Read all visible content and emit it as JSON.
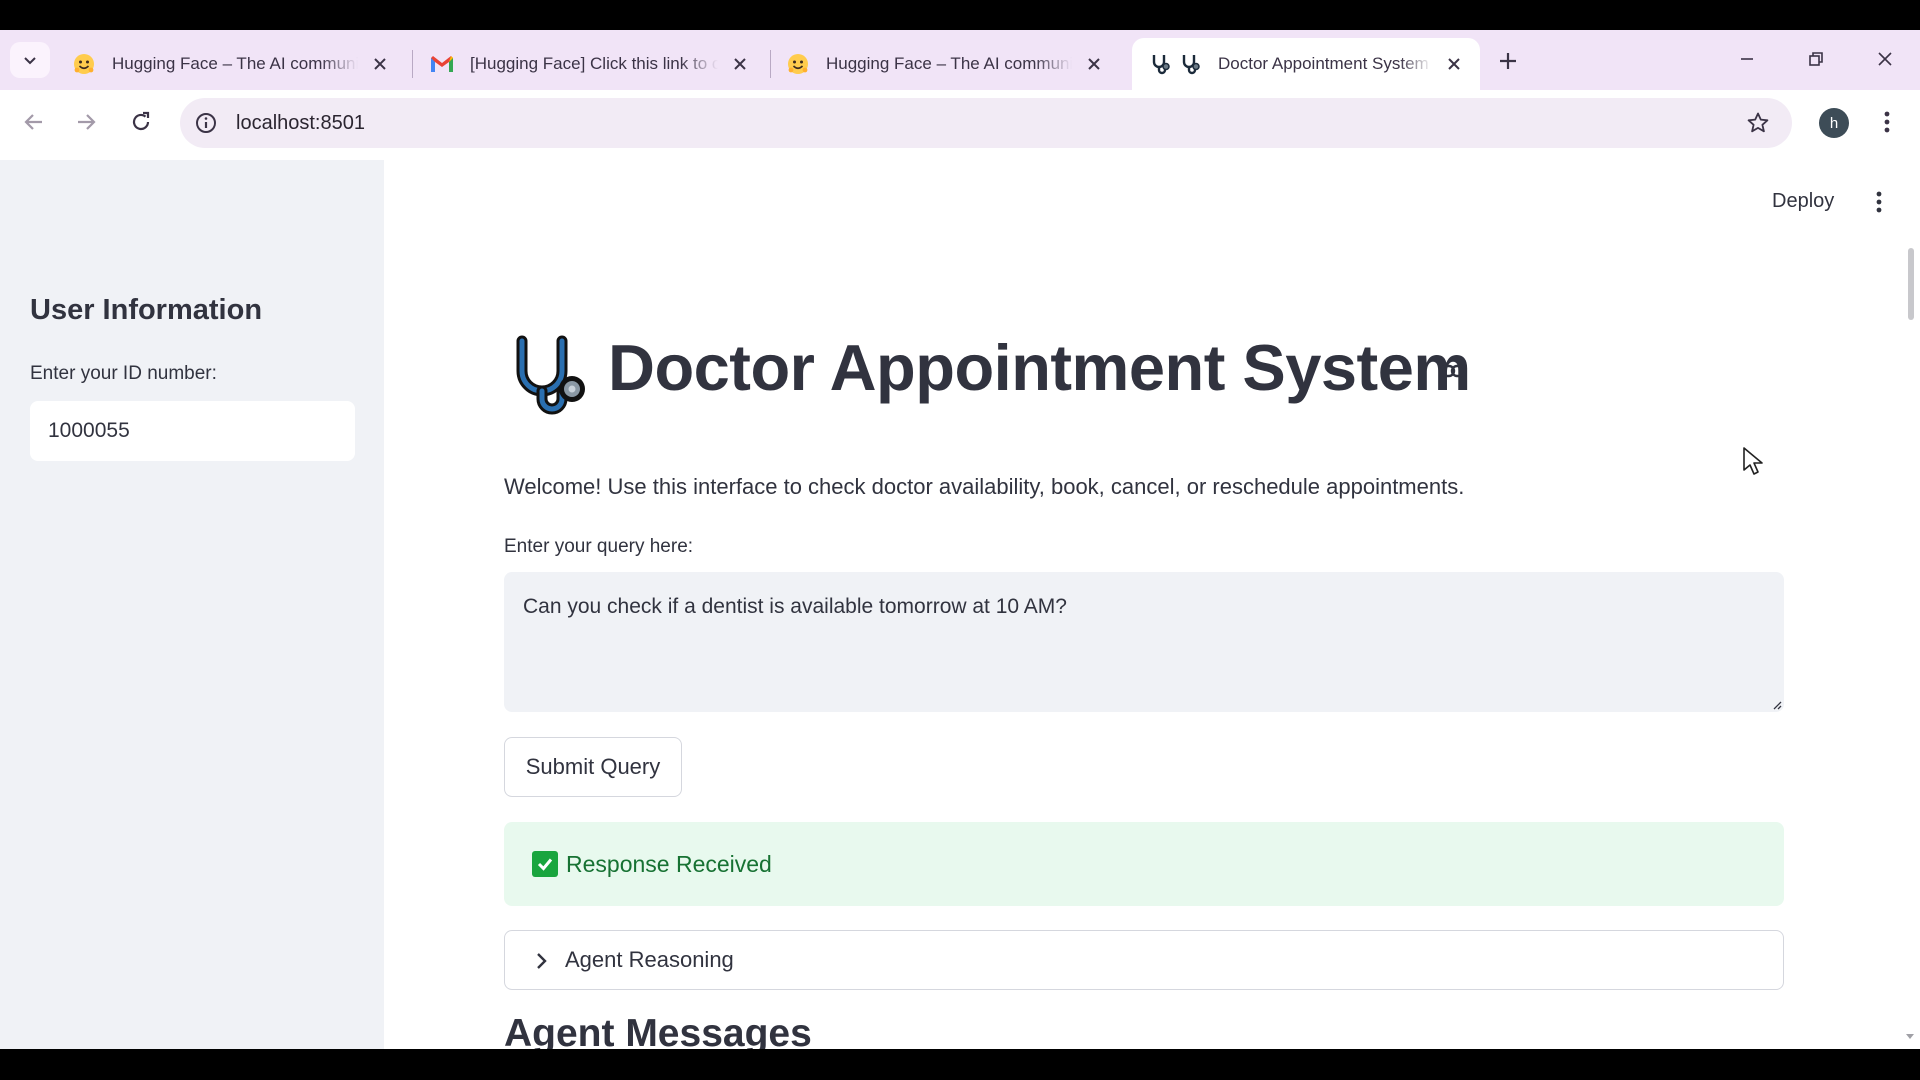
{
  "browser": {
    "tabs": [
      {
        "title": "Hugging Face – The AI community building the future.",
        "favicon": "hugging-face-icon",
        "active": false
      },
      {
        "title": "[Hugging Face] Click this link to confirm your email",
        "favicon": "gmail-icon",
        "active": false
      },
      {
        "title": "Hugging Face – The AI community building the future.",
        "favicon": "hugging-face-icon",
        "active": false
      },
      {
        "title": "Doctor Appointment System",
        "favicon": "stethoscope-icon",
        "active": true
      }
    ],
    "url": "localhost:8501",
    "profile_initial": "h"
  },
  "app": {
    "deploy_label": "Deploy",
    "sidebar": {
      "heading": "User Information",
      "id_label": "Enter your ID number:",
      "id_value": "1000055"
    },
    "main": {
      "title": "Doctor Appointment System",
      "welcome": "Welcome! Use this interface to check doctor availability, book, cancel, or reschedule appointments.",
      "query_label": "Enter your query here:",
      "query_value": "Can you check if a dentist is available tomorrow at 10 AM?",
      "submit_label": "Submit Query",
      "status_message": "Response Received",
      "expander_label": "Agent Reasoning",
      "section_heading": "Agent Messages"
    }
  },
  "colors": {
    "tabstrip_bg": "#f1e4f7",
    "omnibox_bg": "#f2ebf5",
    "sidebar_bg": "#f0f2f6",
    "text": "#31333f",
    "success_bg": "#e8f9ee",
    "success_text": "#177233",
    "success_check": "#19a53e"
  }
}
